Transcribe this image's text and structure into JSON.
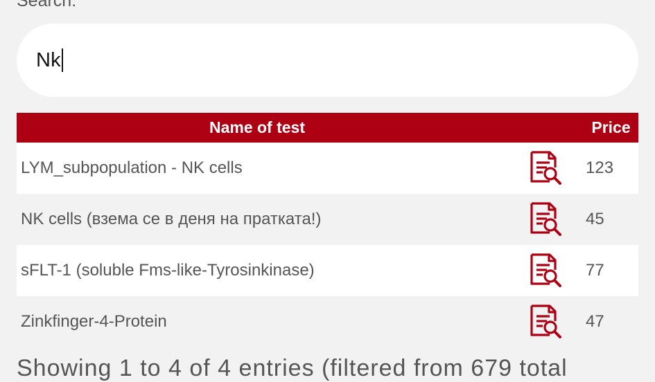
{
  "search": {
    "label": "Search:",
    "value": "Nk"
  },
  "table": {
    "headers": {
      "name": "Name of test",
      "price": "Price"
    },
    "rows": [
      {
        "name": "LYM_subpopulation - NK cells",
        "price": "123",
        "icon": "document-search-icon"
      },
      {
        "name": "NK cells (взема се в деня на пратката!)",
        "price": "45",
        "icon": "document-search-icon"
      },
      {
        "name": "sFLT-1 (soluble Fms-like-Tyrosinkinase)",
        "price": "77",
        "icon": "document-search-icon"
      },
      {
        "name": "Zinkfinger-4-Protein",
        "price": "47",
        "icon": "document-search-icon"
      }
    ]
  },
  "footer": {
    "info": "Showing 1 to 4 of 4 entries (filtered from 679 total"
  },
  "colors": {
    "header_bg": "#ad0013",
    "icon": "#ad0013",
    "text": "#555555",
    "page_bg": "#f2f2f2"
  }
}
